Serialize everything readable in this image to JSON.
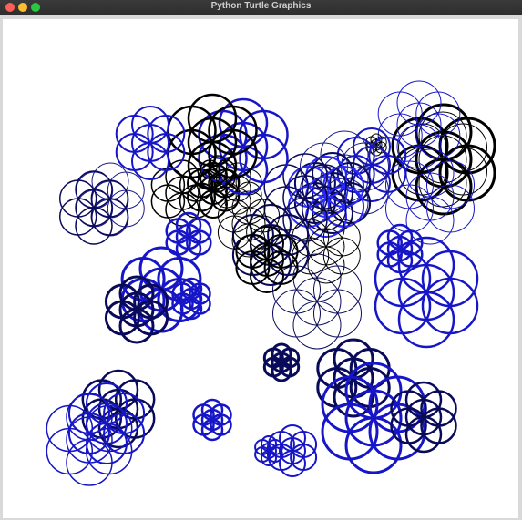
{
  "window": {
    "title": "Python Turtle Graphics",
    "controls": [
      "close",
      "minimize",
      "zoom"
    ]
  },
  "canvas": {
    "background": "#ffffff",
    "palette": [
      "#000000",
      "#0a0a5a",
      "#1a1a8a",
      "#1616c8",
      "#2a2aff"
    ]
  }
}
